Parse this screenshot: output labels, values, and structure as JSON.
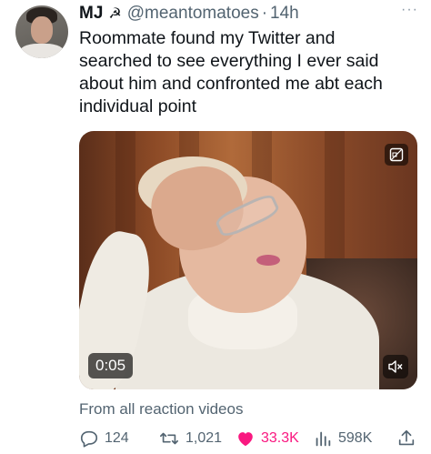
{
  "author": {
    "name": "MJ",
    "symbol": "☭",
    "handle": "@meantomatoes",
    "separator": "·",
    "time": "14h"
  },
  "more_menu": "···",
  "tweet": {
    "lines": [
      "Roommate found my Twitter and",
      "searched to see everything I ever said",
      "about him and confronted me abt each",
      "individual point"
    ]
  },
  "media": {
    "duration": "0:05",
    "gif_icon": "gif-icon",
    "mute_icon": "muted-speaker-icon"
  },
  "source": "From all reaction videos",
  "actions": {
    "replies": "124",
    "reposts": "1,021",
    "likes": "33.3K",
    "views": "598K"
  },
  "colors": {
    "like": "#f91880",
    "secondary_text": "#536471"
  }
}
